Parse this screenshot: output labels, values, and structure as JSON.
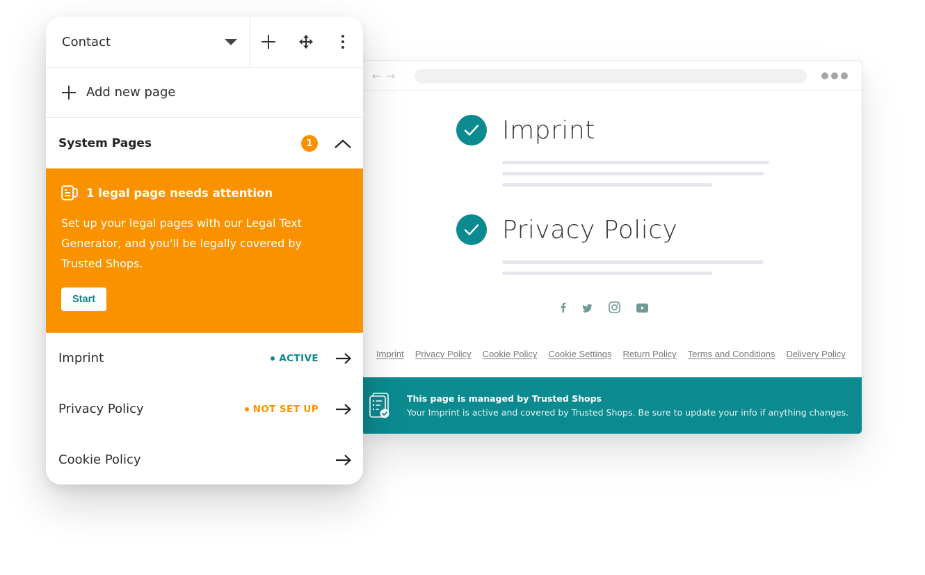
{
  "panel": {
    "header": {
      "selected_page": "Contact",
      "icons": {
        "dropdown": "caret-down-icon",
        "add": "plus-icon",
        "move": "move-icon",
        "more": "more-vertical-icon"
      }
    },
    "add_page_label": "Add new page",
    "system_pages": {
      "label": "System Pages",
      "badge_count": "1",
      "expanded": true
    },
    "attention": {
      "title": "1 legal page needs attention",
      "body": "Set up your legal pages with our Legal Text Generator, and you'll be legally covered by Trusted Shops.",
      "button": "Start"
    },
    "pages": [
      {
        "name": "Imprint",
        "status": "ACTIVE",
        "status_color": "#0b8a8f"
      },
      {
        "name": "Privacy Policy",
        "status": "NOT SET UP",
        "status_color": "#fa9200"
      },
      {
        "name": "Cookie Policy",
        "status": ""
      }
    ]
  },
  "browser": {
    "sections": [
      {
        "title": "Imprint",
        "checked": true
      },
      {
        "title": "Privacy Policy",
        "checked": true
      }
    ],
    "socials": [
      "facebook-icon",
      "twitter-icon",
      "instagram-icon",
      "youtube-icon"
    ],
    "footer_links": [
      "Imprint",
      "Privacy Policy",
      "Cookie Policy",
      "Cookie Settings",
      "Return Policy",
      "Terms and Conditions",
      "Delivery Policy"
    ],
    "banner": {
      "title": "This page is managed by Trusted Shops",
      "text": "Your Imprint is active and covered by Trusted Shops. Be sure to update your info if anything changes."
    }
  },
  "colors": {
    "accent_orange": "#fa9200",
    "accent_teal": "#0b8a8f"
  }
}
